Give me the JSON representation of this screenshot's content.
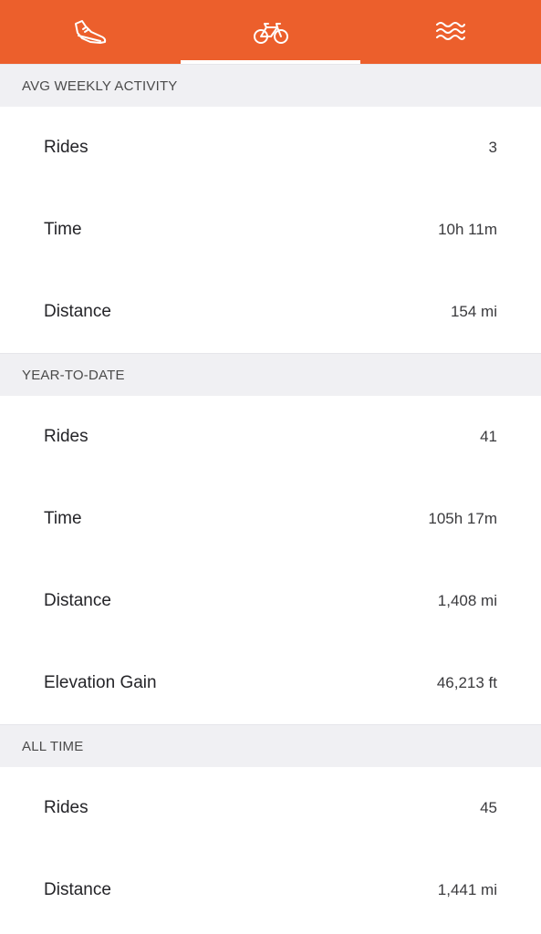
{
  "tabs": [
    {
      "icon": "running-shoe-icon",
      "active": false
    },
    {
      "icon": "bicycle-icon",
      "active": true
    },
    {
      "icon": "swim-waves-icon",
      "active": false
    }
  ],
  "colors": {
    "accent": "#ec5f2c",
    "section_background": "#f0f0f3"
  },
  "sections": [
    {
      "title": "AVG WEEKLY ACTIVITY",
      "rows": [
        {
          "label": "Rides",
          "value": "3"
        },
        {
          "label": "Time",
          "value": "10h 11m"
        },
        {
          "label": "Distance",
          "value": "154 mi"
        }
      ]
    },
    {
      "title": "YEAR-TO-DATE",
      "rows": [
        {
          "label": "Rides",
          "value": "41"
        },
        {
          "label": "Time",
          "value": "105h 17m"
        },
        {
          "label": "Distance",
          "value": "1,408 mi"
        },
        {
          "label": "Elevation Gain",
          "value": "46,213 ft"
        }
      ]
    },
    {
      "title": "ALL TIME",
      "rows": [
        {
          "label": "Rides",
          "value": "45"
        },
        {
          "label": "Distance",
          "value": "1,441 mi"
        }
      ]
    }
  ]
}
